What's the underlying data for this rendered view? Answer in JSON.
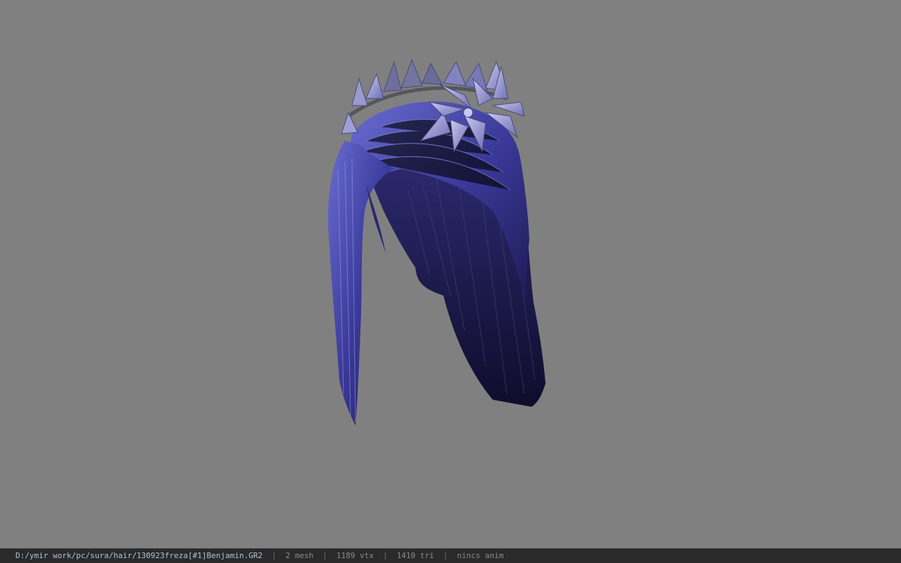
{
  "viewport": {
    "background_color": "#808080",
    "model": {
      "description_icon": "hair-model-with-leaf-crown",
      "hair_color_light": "#5a5cc0",
      "hair_color_dark": "#141238",
      "crown_color": "#9a9ad8"
    }
  },
  "statusbar": {
    "file_path": "D:/ymir work/pc/sura/hair/130923freza[#1]Benjamin.GR2",
    "separator": "|",
    "mesh_count": "2 mesh",
    "vertex_count": "1189 vtx",
    "triangle_count": "1410 tri",
    "anim_status": "nincs anim"
  }
}
